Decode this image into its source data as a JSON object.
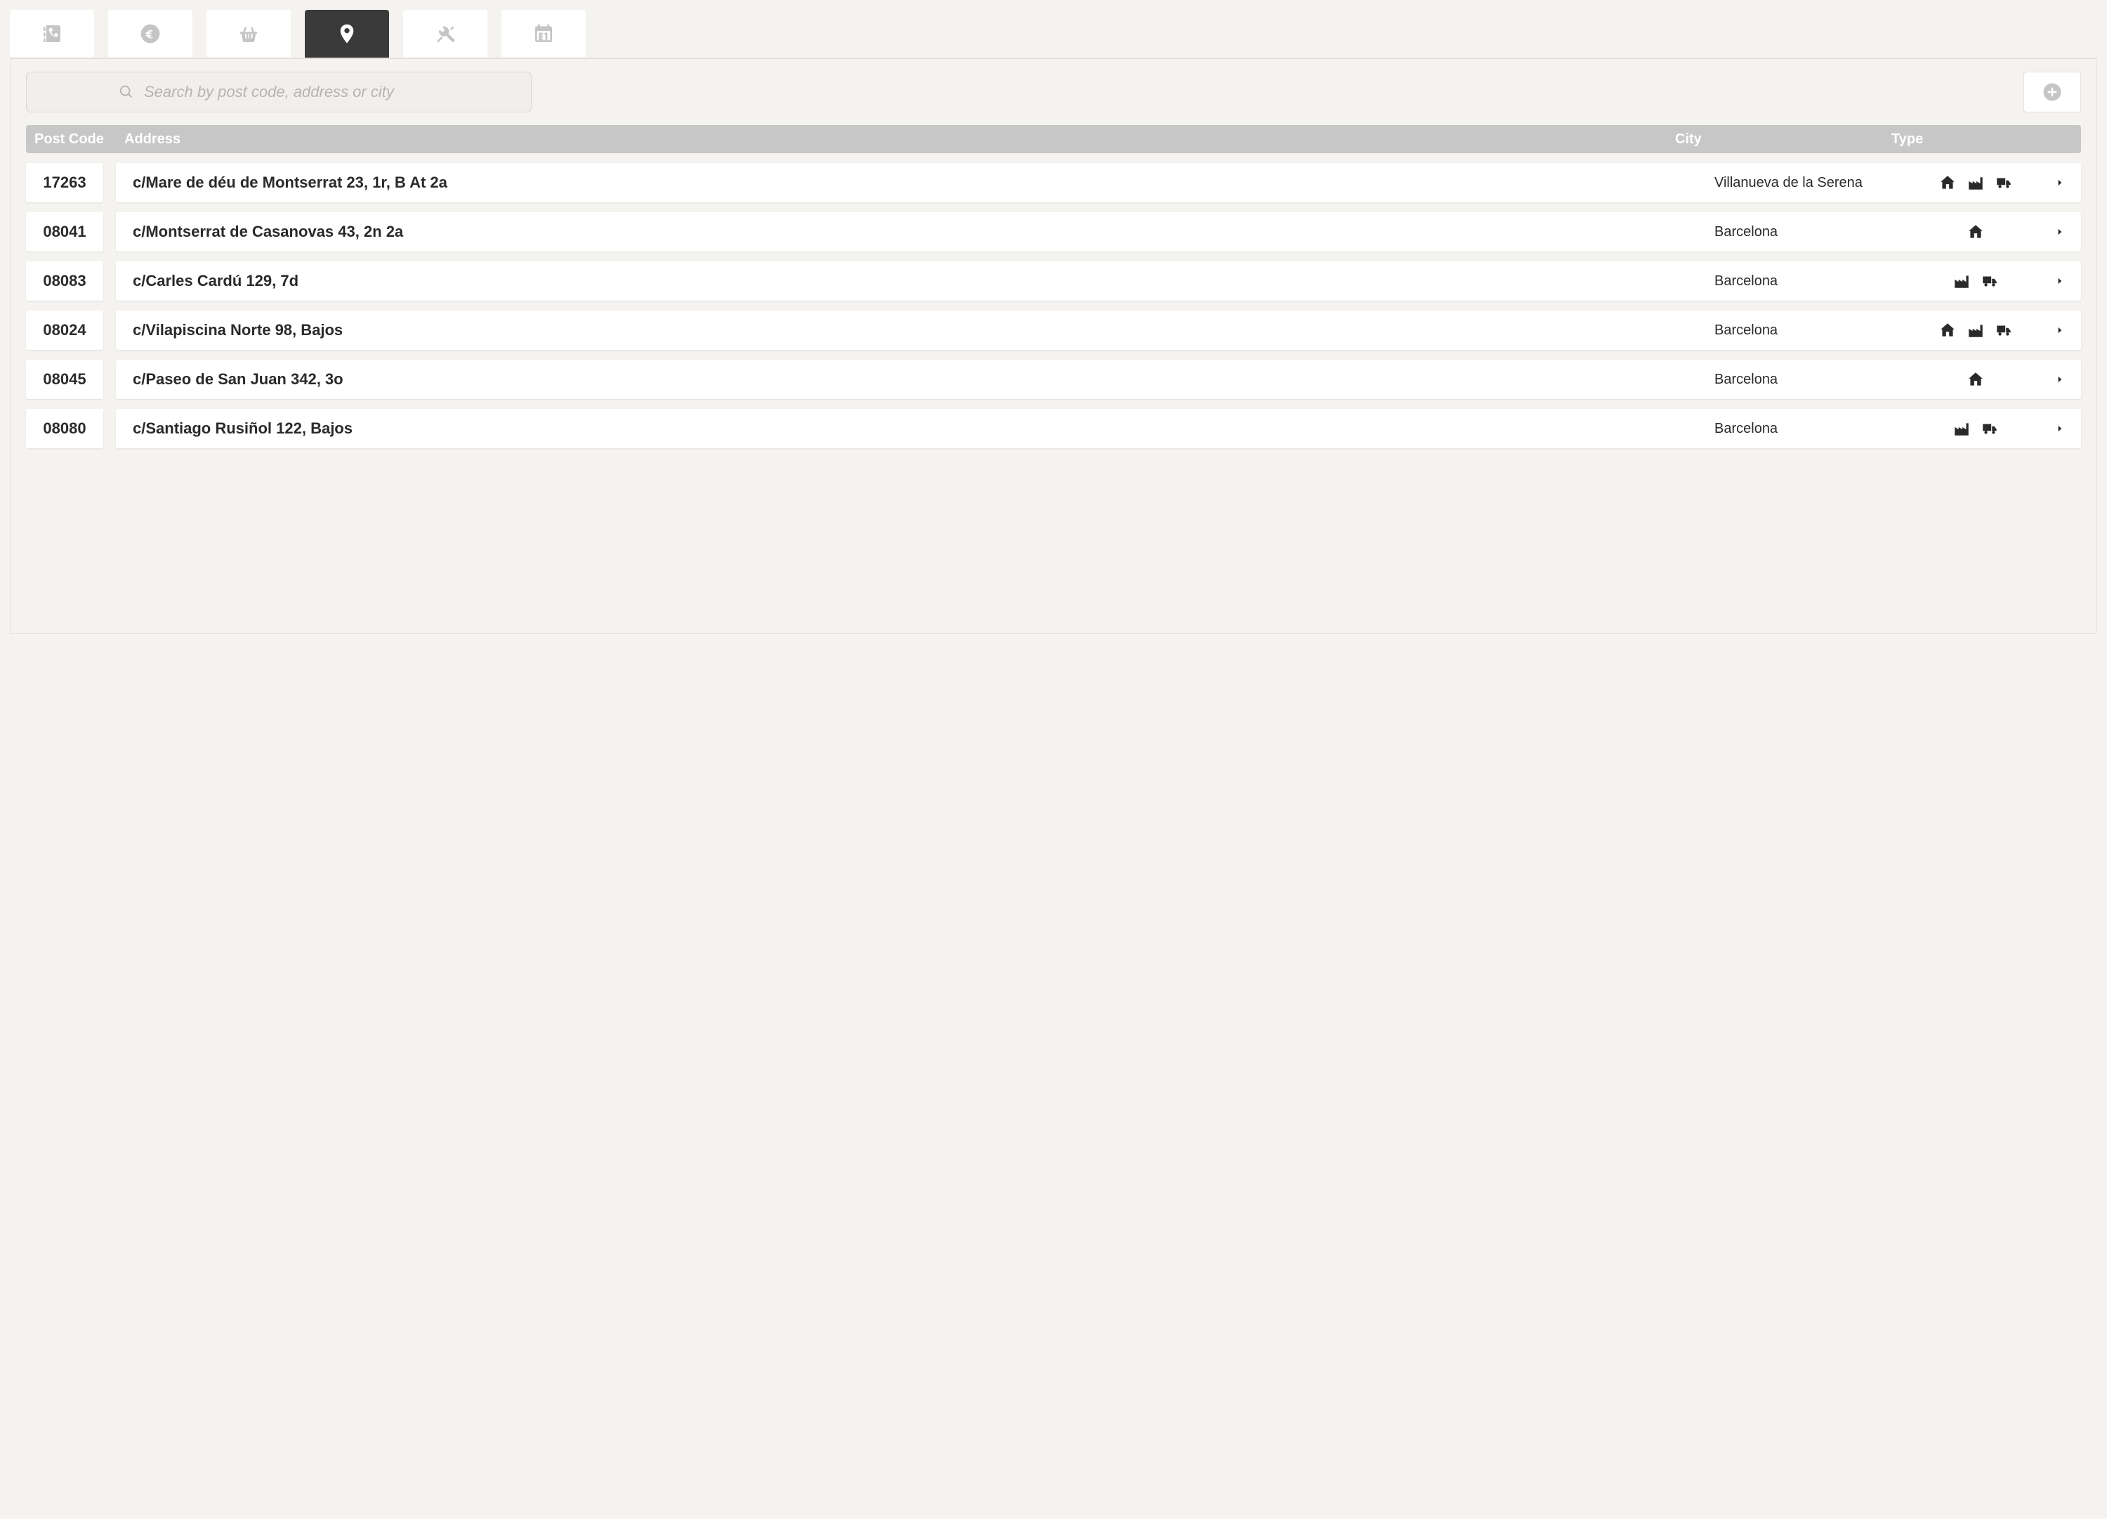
{
  "tabs": [
    {
      "id": "contacts",
      "icon": "phonebook"
    },
    {
      "id": "billing",
      "icon": "euro"
    },
    {
      "id": "orders",
      "icon": "basket"
    },
    {
      "id": "locations",
      "icon": "pin",
      "active": true
    },
    {
      "id": "tools",
      "icon": "wrench"
    },
    {
      "id": "calendar",
      "icon": "calendar"
    }
  ],
  "search": {
    "placeholder": "Search by post code, address or city",
    "value": ""
  },
  "columns": {
    "postcode": "Post Code",
    "address": "Address",
    "city": "City",
    "type": "Type"
  },
  "rows": [
    {
      "postcode": "17263",
      "address": "c/Mare de déu de Montserrat 23, 1r, B At 2a",
      "city": "Villanueva de la Serena",
      "types": [
        "home",
        "factory",
        "truck"
      ]
    },
    {
      "postcode": "08041",
      "address": "c/Montserrat de Casanovas 43, 2n 2a",
      "city": "Barcelona",
      "types": [
        "home"
      ]
    },
    {
      "postcode": "08083",
      "address": "c/Carles Cardú 129, 7d",
      "city": "Barcelona",
      "types": [
        "factory",
        "truck"
      ]
    },
    {
      "postcode": "08024",
      "address": "c/Vilapiscina Norte 98, Bajos",
      "city": "Barcelona",
      "types": [
        "home",
        "factory",
        "truck"
      ]
    },
    {
      "postcode": "08045",
      "address": "c/Paseo de San Juan 342, 3o",
      "city": "Barcelona",
      "types": [
        "home"
      ]
    },
    {
      "postcode": "08080",
      "address": "c/Santiago Rusiñol 122, Bajos",
      "city": "Barcelona",
      "types": [
        "factory",
        "truck"
      ]
    }
  ]
}
